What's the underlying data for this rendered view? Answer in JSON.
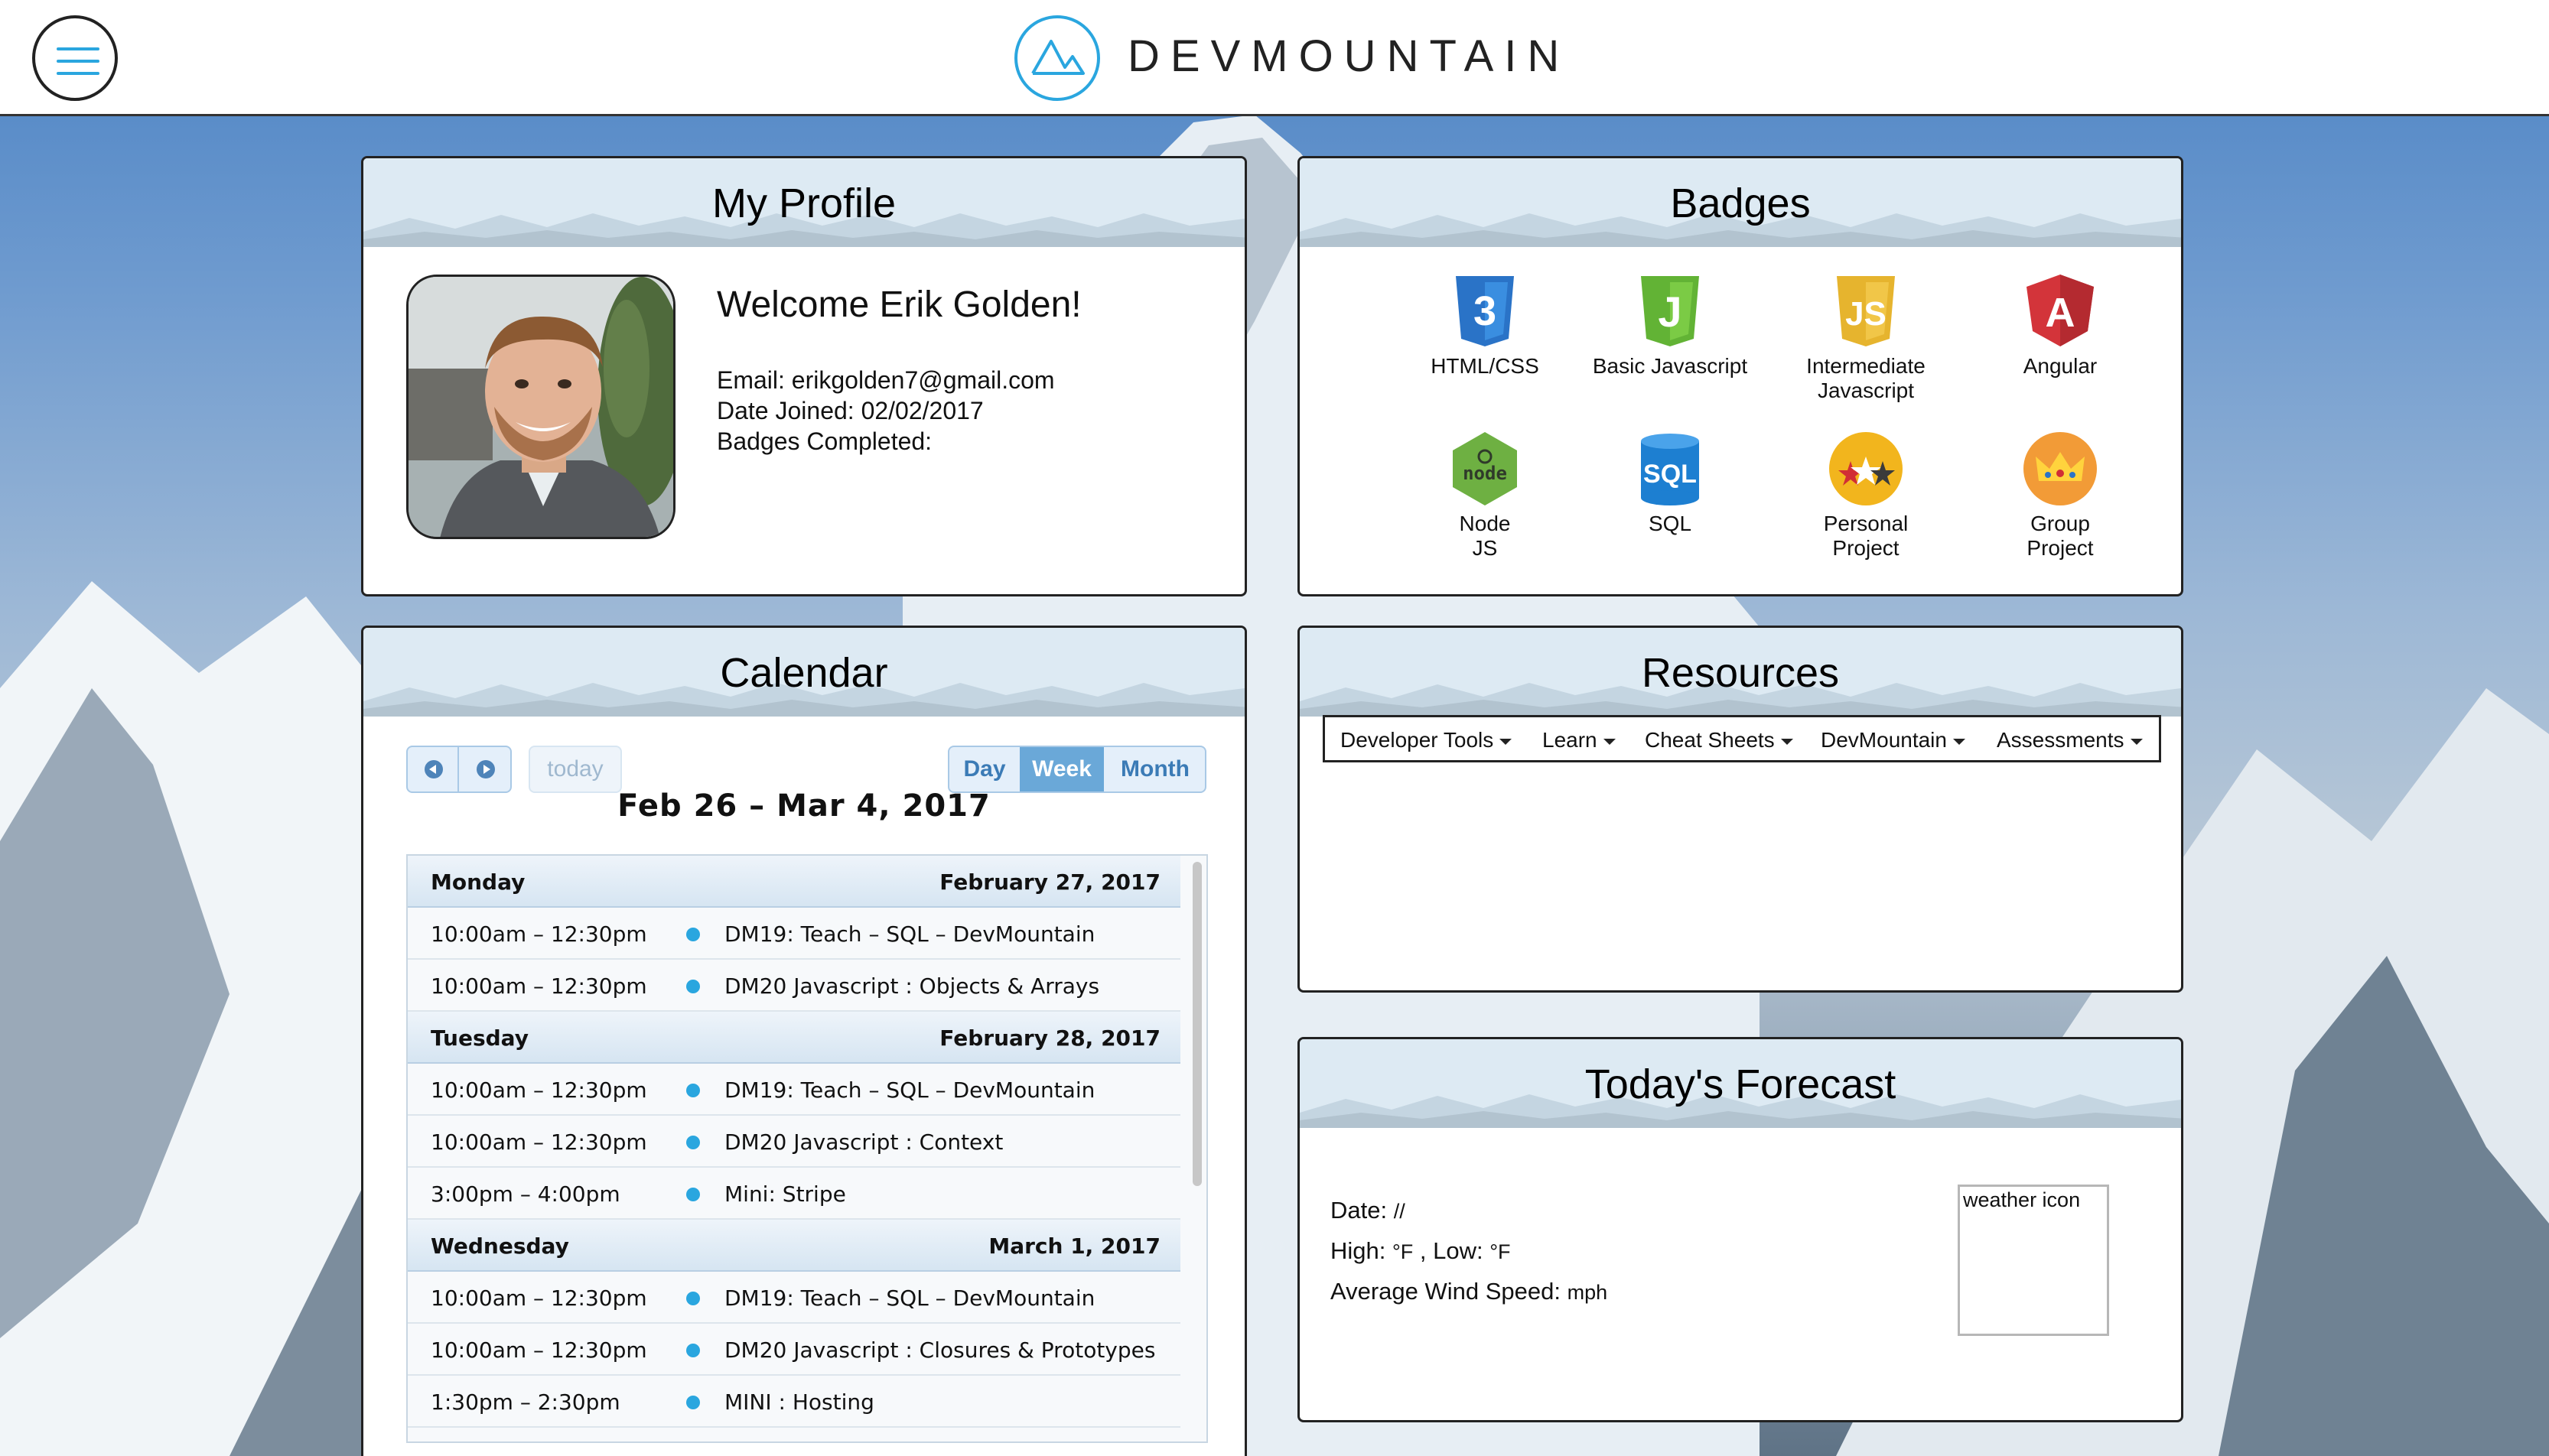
{
  "header": {
    "brand": "DEVMOUNTAIN",
    "menu_icon": "hamburger-menu-icon",
    "logo_icon": "mountain-logo-icon",
    "accent_color": "#2aa6df"
  },
  "profile": {
    "title": "My Profile",
    "welcome": "Welcome Erik Golden!",
    "email_label": "Email:",
    "email": "erikgolden7@gmail.com",
    "joined_label": "Date Joined:",
    "joined": "02/02/2017",
    "badges_label": "Badges Completed:"
  },
  "badges": {
    "title": "Badges",
    "items": [
      {
        "label": "HTML/CSS",
        "icon": "css3-shield-icon",
        "color": "#2a73c7"
      },
      {
        "label": "Basic Javascript",
        "icon": "j-shield-icon",
        "color": "#62b335"
      },
      {
        "label": "Intermediate Javascript",
        "icon": "js-shield-icon",
        "color": "#e6b42e"
      },
      {
        "label": "Angular",
        "icon": "angular-shield-icon",
        "color": "#d3343a"
      },
      {
        "label": "Node JS",
        "icon": "node-hexagon-icon",
        "color": "#6eb042"
      },
      {
        "label": "SQL",
        "icon": "sql-database-icon",
        "color": "#1d7fd1"
      },
      {
        "label": "Personal Project",
        "icon": "stars-circle-icon",
        "color": "#f2b51d"
      },
      {
        "label": "Group Project",
        "icon": "crown-circle-icon",
        "color": "#f29b37"
      }
    ]
  },
  "calendar": {
    "title": "Calendar",
    "today_label": "today",
    "views": {
      "day": "Day",
      "week": "Week",
      "month": "Month"
    },
    "active_view": "Week",
    "range": "Feb 26 – Mar 4, 2017",
    "rows": [
      {
        "kind": "day",
        "day": "Monday",
        "date": "February 27, 2017"
      },
      {
        "kind": "event",
        "time": "10:00am – 12:30pm",
        "title": "DM19: Teach – SQL – DevMountain"
      },
      {
        "kind": "event",
        "time": "10:00am – 12:30pm",
        "title": "DM20 Javascript : Objects & Arrays"
      },
      {
        "kind": "day",
        "day": "Tuesday",
        "date": "February 28, 2017"
      },
      {
        "kind": "event",
        "time": "10:00am – 12:30pm",
        "title": "DM19: Teach – SQL – DevMountain"
      },
      {
        "kind": "event",
        "time": "10:00am – 12:30pm",
        "title": "DM20 Javascript : Context"
      },
      {
        "kind": "event",
        "time": "3:00pm – 4:00pm",
        "title": "Mini: Stripe"
      },
      {
        "kind": "day",
        "day": "Wednesday",
        "date": "March 1, 2017"
      },
      {
        "kind": "event",
        "time": "10:00am – 12:30pm",
        "title": "DM19: Teach – SQL – DevMountain"
      },
      {
        "kind": "event",
        "time": "10:00am – 12:30pm",
        "title": "DM20 Javascript : Closures & Prototypes"
      },
      {
        "kind": "event",
        "time": "1:30pm – 2:30pm",
        "title": "MINI : Hosting"
      }
    ],
    "event_color": "#2aa6df"
  },
  "resources": {
    "title": "Resources",
    "menu": [
      "Developer Tools",
      "Learn",
      "Cheat Sheets",
      "DevMountain",
      "Assessments"
    ]
  },
  "forecast": {
    "title": "Today's Forecast",
    "date_label": "Date:",
    "date_value": "//",
    "high_label": "High:",
    "high_value": "°F",
    "low_label": "Low:",
    "low_value": "°F",
    "wind_label": "Average Wind Speed:",
    "wind_value": "mph",
    "weather_icon_alt": "weather icon"
  }
}
